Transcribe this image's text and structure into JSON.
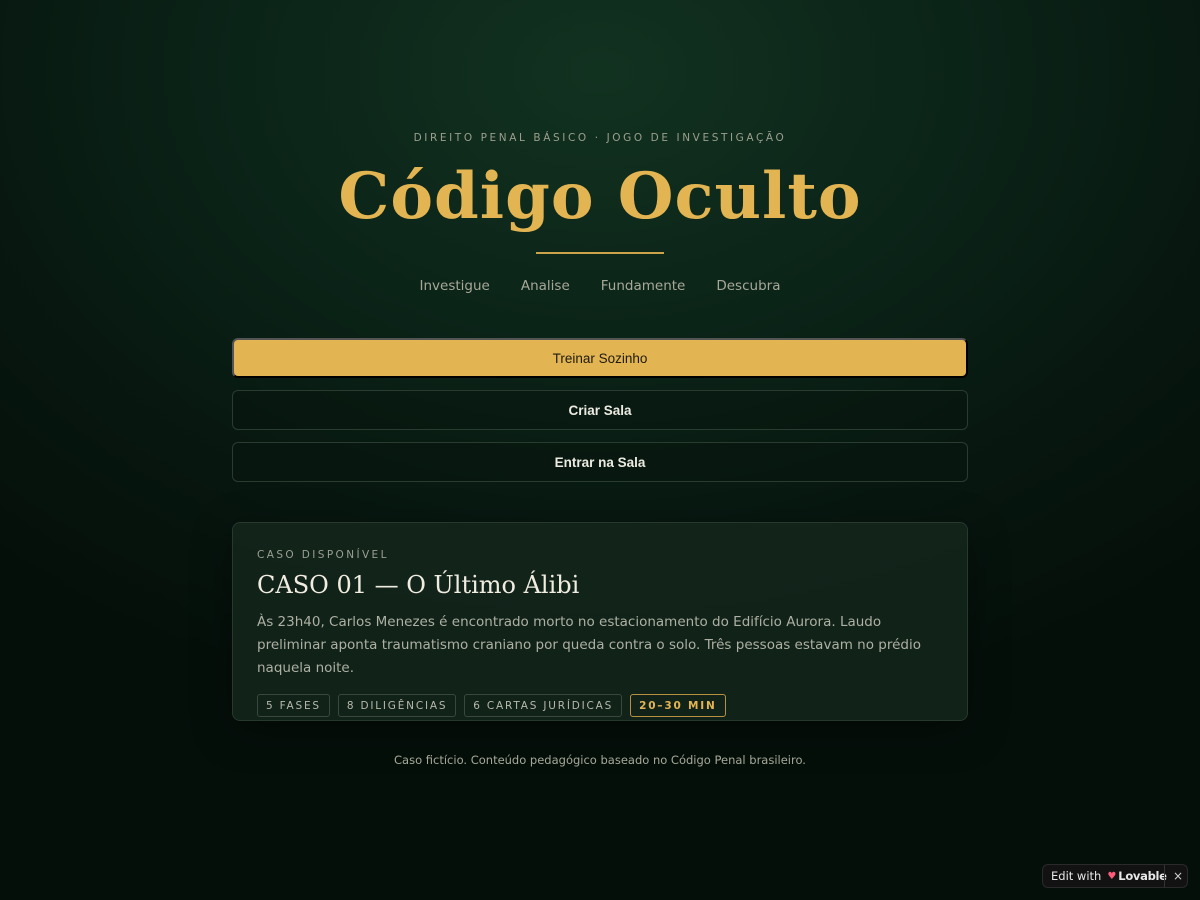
{
  "header": {
    "kicker": "DIREITO PENAL BÁSICO · JOGO DE INVESTIGAÇÃO",
    "title": "Código Oculto",
    "tagline": [
      "Investigue",
      "Analise",
      "Fundamente",
      "Descubra"
    ]
  },
  "actions": {
    "train_label": "Treinar Sozinho",
    "create_label": "Criar Sala",
    "join_label": "Entrar na Sala"
  },
  "case": {
    "kicker": "CASO DISPONÍVEL",
    "title": "CASO 01 — O Último Álibi",
    "description": "Às 23h40, Carlos Menezes é encontrado morto no estacionamento do Edifício Aurora. Laudo preliminar aponta traumatismo craniano por queda contra o solo. Três pessoas estavam no prédio naquela noite.",
    "tags": [
      "5 FASES",
      "8 DILIGÊNCIAS",
      "6 CARTAS JURÍDICAS",
      "20–30 MIN"
    ]
  },
  "footer": {
    "note": "Caso fictício. Conteúdo pedagógico baseado no Código Penal brasileiro."
  },
  "badge": {
    "edit_label": "Edit with",
    "brand": "Lovable",
    "close_glyph": "×",
    "icon": "heart-icon"
  },
  "colors": {
    "accent": "#e3b552",
    "background": "#07160f"
  }
}
